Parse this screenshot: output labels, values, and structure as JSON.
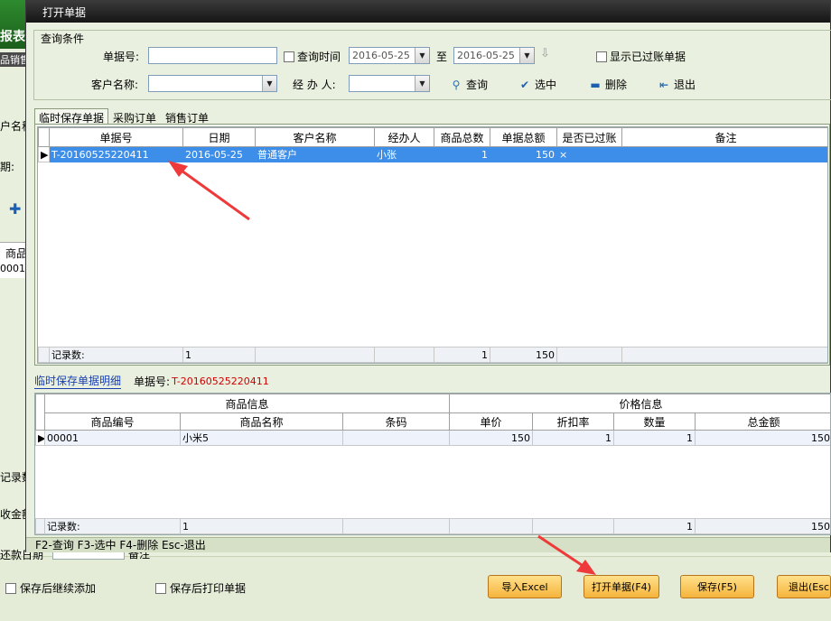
{
  "background": {
    "logo_text": "报表",
    "logo_sub": "品销售",
    "labels": [
      {
        "id": "customer",
        "text": "户名称"
      },
      {
        "id": "date",
        "text": "期:"
      },
      {
        "id": "goods",
        "text": "商品"
      },
      {
        "id": "row_value",
        "text": "0001"
      },
      {
        "id": "record_count",
        "text": "记录数"
      },
      {
        "id": "amount",
        "text": "收金额"
      },
      {
        "id": "pay_date",
        "text": "还款日期"
      },
      {
        "id": "remark",
        "text": "备注"
      }
    ],
    "checkbox_continue": "保存后继续添加",
    "checkbox_print": "保存后打印单据",
    "buttons": {
      "import_excel": "导入Excel",
      "open_doc": "打开单据(F4)",
      "save": "保存(F5)",
      "exit": "退出(Esc)"
    }
  },
  "dialog": {
    "title": "打开单据",
    "query": {
      "legend": "查询条件",
      "doc_no_label": "单据号:",
      "doc_no_value": "",
      "query_time_label": "查询时间",
      "date_from": "2016-05-25",
      "to_label": "至",
      "date_to": "2016-05-25",
      "show_posted_label": "显示已过账单据",
      "customer_label": "客户名称:",
      "customer_value": "",
      "handler_label": "经 办 人:",
      "handler_value": "",
      "search_label": "查询",
      "select_label": "选中",
      "delete_label": "删除",
      "exit_label": "退出"
    },
    "tabs": [
      "临时保存单据",
      "采购订单",
      "销售订单"
    ],
    "master_grid": {
      "headers": [
        "单据号",
        "日期",
        "客户名称",
        "经办人",
        "商品总数",
        "单据总额",
        "是否已过账",
        "备注"
      ],
      "rows": [
        [
          "T-20160525220411",
          "2016-05-25",
          "普通客户",
          "小张",
          "1",
          "150",
          "×",
          ""
        ]
      ],
      "footer": {
        "label": "记录数:",
        "count": "1",
        "total_qty": "1",
        "total_amount": "150"
      }
    },
    "detail": {
      "tab_label": "临时保存单据明细",
      "doc_no_label": "单据号:",
      "doc_no_value": "T-20160525220411",
      "group_goods": "商品信息",
      "group_price": "价格信息",
      "headers": [
        "商品编号",
        "商品名称",
        "条码",
        "单价",
        "折扣率",
        "数量",
        "总金额"
      ],
      "rows": [
        [
          "00001",
          "小米5",
          "",
          "150",
          "1",
          "1",
          "150"
        ]
      ],
      "footer": {
        "label": "记录数:",
        "count": "1",
        "qty": "1",
        "amount": "150"
      }
    },
    "status_bar": "F2-查询 F3-选中 F4-删除 Esc-退出"
  }
}
